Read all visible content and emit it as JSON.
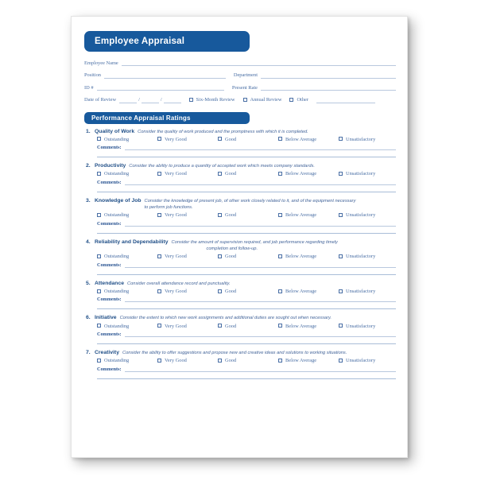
{
  "document": {
    "title_banner": "Employee Appraisal",
    "ratings_banner": "Performance Appraisal Ratings"
  },
  "identity": {
    "employee_name_label": "Employee Name",
    "position_label": "Position",
    "department_label": "Department",
    "id_label": "ID #",
    "present_rate_label": "Present Rate",
    "date_of_review_label": "Date of Review",
    "date_separator": "/",
    "review_types": [
      "Six-Month Review",
      "Annual Review",
      "Other"
    ]
  },
  "rating_scale": [
    "Outstanding",
    "Very Good",
    "Good",
    "Below Average",
    "Unsatisfactory"
  ],
  "comments_label": "Comments:",
  "items": [
    {
      "number": "1.",
      "title": "Quality of Work",
      "desc_line1": "Consider the quality of work produced and the promptness with which it is completed.",
      "desc_line2": ""
    },
    {
      "number": "2.",
      "title": "Productivity",
      "desc_line1": "Consider the ability to produce a quantity of accepted work which meets company standards.",
      "desc_line2": ""
    },
    {
      "number": "3.",
      "title": "Knowledge of Job",
      "desc_line1": "Consider the knowledge of present job, of other work closely related to it, and of the equipment necessary",
      "desc_line2": "to perform job functions."
    },
    {
      "number": "4.",
      "title": "Reliability and Dependability",
      "desc_line1": "Consider the amount of supervision required, and job performance regarding timely",
      "desc_line2": "completion and follow-up."
    },
    {
      "number": "5.",
      "title": "Attendance",
      "desc_line1": "Consider overall attendance record and punctuality.",
      "desc_line2": ""
    },
    {
      "number": "6.",
      "title": "Initiative",
      "desc_line1": "Consider the extent to which new work assignments and additional duties are sought out when necessary.",
      "desc_line2": ""
    },
    {
      "number": "7.",
      "title": "Creativity",
      "desc_line1": "Consider the ability to offer suggestions and propose new and creative ideas and solutions to working situations.",
      "desc_line2": ""
    }
  ],
  "colors": {
    "banner_blue": "#17599c",
    "heading_blue": "#1f4e87",
    "label_blue": "#4a6fa5",
    "rule_blue": "#b9c8de",
    "paper_white": "#ffffff"
  }
}
